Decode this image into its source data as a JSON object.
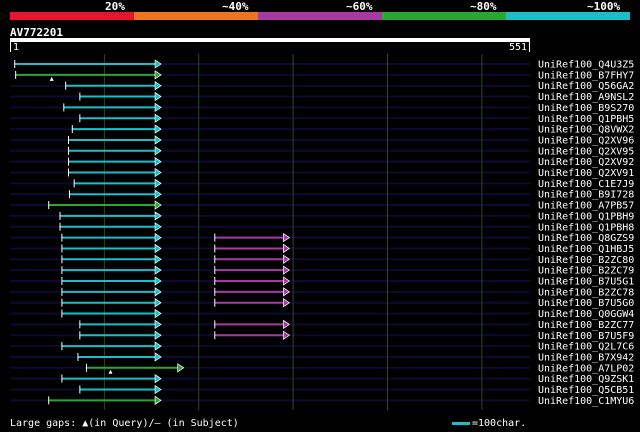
{
  "legend": {
    "segments": [
      {
        "label": "20%",
        "color": "#e8132e"
      },
      {
        "label": "~40%",
        "color": "#ec7320"
      },
      {
        "label": "~60%",
        "color": "#a63aa1"
      },
      {
        "label": "~80%",
        "color": "#2ba631"
      },
      {
        "label": "~100%",
        "color": "#19bfc8"
      }
    ]
  },
  "query": {
    "id": "AV772201",
    "start": "1",
    "end": "551",
    "length": 551
  },
  "colors": {
    "grid": "#2a4a2a",
    "row": "#0a0a33",
    "cyan": "#19bfc8",
    "green": "#2ba631",
    "purple": "#a63aa1"
  },
  "hits": [
    {
      "name": "UniRef100_Q4U3Z5",
      "segments": [
        {
          "from": 5,
          "to": 159,
          "color": "cyan"
        }
      ]
    },
    {
      "name": "UniRef100_B7FHY7",
      "segments": [
        {
          "from": 6,
          "to": 159,
          "color": "green",
          "gap": 11
        }
      ]
    },
    {
      "name": "UniRef100_Q56GA2",
      "segments": [
        {
          "from": 59,
          "to": 159,
          "color": "cyan"
        }
      ]
    },
    {
      "name": "UniRef100_A9NSL2",
      "segments": [
        {
          "from": 74,
          "to": 159,
          "color": "cyan"
        }
      ]
    },
    {
      "name": "UniRef100_B9S270",
      "segments": [
        {
          "from": 57,
          "to": 159,
          "color": "cyan"
        }
      ]
    },
    {
      "name": "UniRef100_Q1PBH5",
      "segments": [
        {
          "from": 74,
          "to": 159,
          "color": "cyan"
        }
      ]
    },
    {
      "name": "UniRef100_Q8VWX2",
      "segments": [
        {
          "from": 66,
          "to": 159,
          "color": "cyan"
        }
      ]
    },
    {
      "name": "UniRef100_Q2XV96",
      "segments": [
        {
          "from": 62,
          "to": 159,
          "color": "cyan"
        }
      ]
    },
    {
      "name": "UniRef100_Q2XV95",
      "segments": [
        {
          "from": 62,
          "to": 159,
          "color": "cyan"
        }
      ]
    },
    {
      "name": "UniRef100_Q2XV92",
      "segments": [
        {
          "from": 62,
          "to": 159,
          "color": "cyan"
        }
      ]
    },
    {
      "name": "UniRef100_Q2XV91",
      "segments": [
        {
          "from": 62,
          "to": 159,
          "color": "cyan"
        }
      ]
    },
    {
      "name": "UniRef100_C1E7J9",
      "segments": [
        {
          "from": 68,
          "to": 159,
          "color": "cyan"
        }
      ]
    },
    {
      "name": "UniRef100_B9I728",
      "segments": [
        {
          "from": 63,
          "to": 159,
          "color": "cyan"
        }
      ]
    },
    {
      "name": "UniRef100_A7PB57",
      "segments": [
        {
          "from": 41,
          "to": 159,
          "color": "green"
        }
      ]
    },
    {
      "name": "UniRef100_Q1PBH9",
      "segments": [
        {
          "from": 53,
          "to": 159,
          "color": "cyan"
        }
      ]
    },
    {
      "name": "UniRef100_Q1PBH8",
      "segments": [
        {
          "from": 53,
          "to": 159,
          "color": "cyan"
        }
      ]
    },
    {
      "name": "UniRef100_Q8GZS9",
      "segments": [
        {
          "from": 55,
          "to": 159,
          "color": "cyan"
        },
        {
          "from": 217,
          "to": 295,
          "color": "purple"
        }
      ]
    },
    {
      "name": "UniRef100_Q1HBJ5",
      "segments": [
        {
          "from": 55,
          "to": 159,
          "color": "cyan"
        },
        {
          "from": 217,
          "to": 295,
          "color": "purple"
        }
      ]
    },
    {
      "name": "UniRef100_B2ZC80",
      "segments": [
        {
          "from": 55,
          "to": 159,
          "color": "cyan"
        },
        {
          "from": 217,
          "to": 295,
          "color": "purple"
        }
      ]
    },
    {
      "name": "UniRef100_B2ZC79",
      "segments": [
        {
          "from": 55,
          "to": 159,
          "color": "cyan"
        },
        {
          "from": 217,
          "to": 295,
          "color": "purple"
        }
      ]
    },
    {
      "name": "UniRef100_B7U5G1",
      "segments": [
        {
          "from": 55,
          "to": 159,
          "color": "cyan"
        },
        {
          "from": 217,
          "to": 295,
          "color": "purple"
        }
      ]
    },
    {
      "name": "UniRef100_B2ZC78",
      "segments": [
        {
          "from": 55,
          "to": 159,
          "color": "cyan"
        },
        {
          "from": 217,
          "to": 295,
          "color": "purple"
        }
      ]
    },
    {
      "name": "UniRef100_B7U5G0",
      "segments": [
        {
          "from": 55,
          "to": 159,
          "color": "cyan"
        },
        {
          "from": 217,
          "to": 295,
          "color": "purple"
        }
      ]
    },
    {
      "name": "UniRef100_Q0GGW4",
      "segments": [
        {
          "from": 55,
          "to": 159,
          "color": "cyan"
        }
      ]
    },
    {
      "name": "UniRef100_B2ZC77",
      "segments": [
        {
          "from": 74,
          "to": 159,
          "color": "cyan"
        },
        {
          "from": 217,
          "to": 295,
          "color": "purple"
        }
      ]
    },
    {
      "name": "UniRef100_B7U5F9",
      "segments": [
        {
          "from": 74,
          "to": 159,
          "color": "cyan"
        },
        {
          "from": 217,
          "to": 295,
          "color": "purple"
        }
      ]
    },
    {
      "name": "UniRef100_Q2L7C6",
      "segments": [
        {
          "from": 55,
          "to": 159,
          "color": "cyan"
        }
      ]
    },
    {
      "name": "UniRef100_B7X942",
      "segments": [
        {
          "from": 72,
          "to": 159,
          "color": "cyan"
        }
      ]
    },
    {
      "name": "UniRef100_A7LP02",
      "segments": [
        {
          "from": 81,
          "to": 183,
          "color": "green",
          "gap": 104
        }
      ]
    },
    {
      "name": "UniRef100_Q9ZSK1",
      "segments": [
        {
          "from": 55,
          "to": 159,
          "color": "cyan"
        }
      ]
    },
    {
      "name": "UniRef100_Q5CB51",
      "segments": [
        {
          "from": 74,
          "to": 159,
          "color": "cyan"
        }
      ]
    },
    {
      "name": "UniRef100_C1MYU6",
      "segments": [
        {
          "from": 41,
          "to": 159,
          "color": "green"
        }
      ]
    }
  ],
  "footer": {
    "gaps_text": "Large gaps: ▲(in Query)/– (in Subject)",
    "scale_text": "=100char."
  }
}
